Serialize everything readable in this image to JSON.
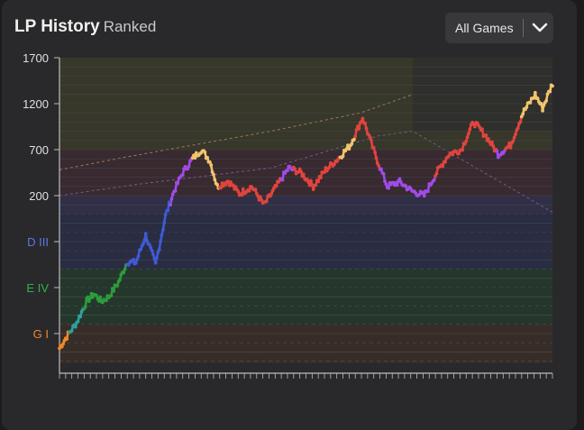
{
  "header": {
    "title": "LP History",
    "subtitle": "Ranked"
  },
  "filter": {
    "selected": "All Games",
    "icon": "chevron-down-icon"
  },
  "colors": {
    "background": "#29292b",
    "gold": "#f2c46b",
    "platinum": "#e0443e",
    "diamond_tier": "#a14be8",
    "diamond": "#3e5bd6",
    "emerald": "#2c9c3c",
    "teal": "#2fa09a",
    "bronze": "#f08a28",
    "grid": "#5a5a70"
  },
  "chart_data": {
    "type": "line",
    "title": "LP History",
    "y_ticks": [
      {
        "label": "1700",
        "value": 1700,
        "color": "#e0e0e0"
      },
      {
        "label": "1200",
        "value": 1200,
        "color": "#e0e0e0"
      },
      {
        "label": "700",
        "value": 700,
        "color": "#e0e0e0"
      },
      {
        "label": "200",
        "value": 200,
        "color": "#e0e0e0"
      },
      {
        "label": "D III",
        "value": -300,
        "color": "#5b78e6"
      },
      {
        "label": "E IV",
        "value": -800,
        "color": "#34b04a"
      },
      {
        "label": "G I",
        "value": -1300,
        "color": "#f08a28"
      }
    ],
    "ylim": [
      -1620,
      1700
    ],
    "n_games": 400,
    "series_color_bands": [
      {
        "from": 0,
        "to": 8,
        "color": "#f08a28"
      },
      {
        "from": 8,
        "to": 20,
        "color": "#2fa09a"
      },
      {
        "from": 20,
        "to": 55,
        "color": "#2c9c3c"
      },
      {
        "from": 55,
        "to": 90,
        "color": "#3e5bd6"
      },
      {
        "from": 90,
        "to": 108,
        "color": "#a14be8"
      },
      {
        "from": 108,
        "to": 130,
        "color": "#f2c46b"
      },
      {
        "from": 130,
        "to": 180,
        "color": "#e0443e"
      },
      {
        "from": 180,
        "to": 190,
        "color": "#a14be8"
      },
      {
        "from": 190,
        "to": 228,
        "color": "#e0443e"
      },
      {
        "from": 228,
        "to": 240,
        "color": "#f2c46b"
      },
      {
        "from": 240,
        "to": 260,
        "color": "#e0443e"
      },
      {
        "from": 260,
        "to": 305,
        "color": "#a14be8"
      },
      {
        "from": 305,
        "to": 355,
        "color": "#e0443e"
      },
      {
        "from": 355,
        "to": 362,
        "color": "#a14be8"
      },
      {
        "from": 362,
        "to": 375,
        "color": "#e0443e"
      },
      {
        "from": 375,
        "to": 400,
        "color": "#f2c46b"
      }
    ],
    "keypoints": [
      {
        "game": 0,
        "lp": -1460
      },
      {
        "game": 6,
        "lp": -1330
      },
      {
        "game": 14,
        "lp": -1180
      },
      {
        "game": 22,
        "lp": -950
      },
      {
        "game": 28,
        "lp": -870
      },
      {
        "game": 34,
        "lp": -950
      },
      {
        "game": 40,
        "lp": -900
      },
      {
        "game": 48,
        "lp": -740
      },
      {
        "game": 55,
        "lp": -520
      },
      {
        "game": 62,
        "lp": -530
      },
      {
        "game": 70,
        "lp": -230
      },
      {
        "game": 78,
        "lp": -550
      },
      {
        "game": 86,
        "lp": -20
      },
      {
        "game": 93,
        "lp": 250
      },
      {
        "game": 100,
        "lp": 450
      },
      {
        "game": 108,
        "lp": 600
      },
      {
        "game": 115,
        "lp": 700
      },
      {
        "game": 122,
        "lp": 580
      },
      {
        "game": 128,
        "lp": 300
      },
      {
        "game": 137,
        "lp": 360
      },
      {
        "game": 146,
        "lp": 220
      },
      {
        "game": 156,
        "lp": 300
      },
      {
        "game": 166,
        "lp": 100
      },
      {
        "game": 176,
        "lp": 300
      },
      {
        "game": 186,
        "lp": 500
      },
      {
        "game": 196,
        "lp": 450
      },
      {
        "game": 206,
        "lp": 300
      },
      {
        "game": 216,
        "lp": 480
      },
      {
        "game": 226,
        "lp": 600
      },
      {
        "game": 236,
        "lp": 750
      },
      {
        "game": 246,
        "lp": 1050
      },
      {
        "game": 256,
        "lp": 650
      },
      {
        "game": 266,
        "lp": 300
      },
      {
        "game": 276,
        "lp": 350
      },
      {
        "game": 286,
        "lp": 250
      },
      {
        "game": 296,
        "lp": 200
      },
      {
        "game": 306,
        "lp": 450
      },
      {
        "game": 316,
        "lp": 650
      },
      {
        "game": 326,
        "lp": 700
      },
      {
        "game": 336,
        "lp": 1000
      },
      {
        "game": 346,
        "lp": 850
      },
      {
        "game": 356,
        "lp": 650
      },
      {
        "game": 366,
        "lp": 750
      },
      {
        "game": 376,
        "lp": 1100
      },
      {
        "game": 386,
        "lp": 1300
      },
      {
        "game": 392,
        "lp": 1150
      },
      {
        "game": 400,
        "lp": 1420
      }
    ]
  }
}
